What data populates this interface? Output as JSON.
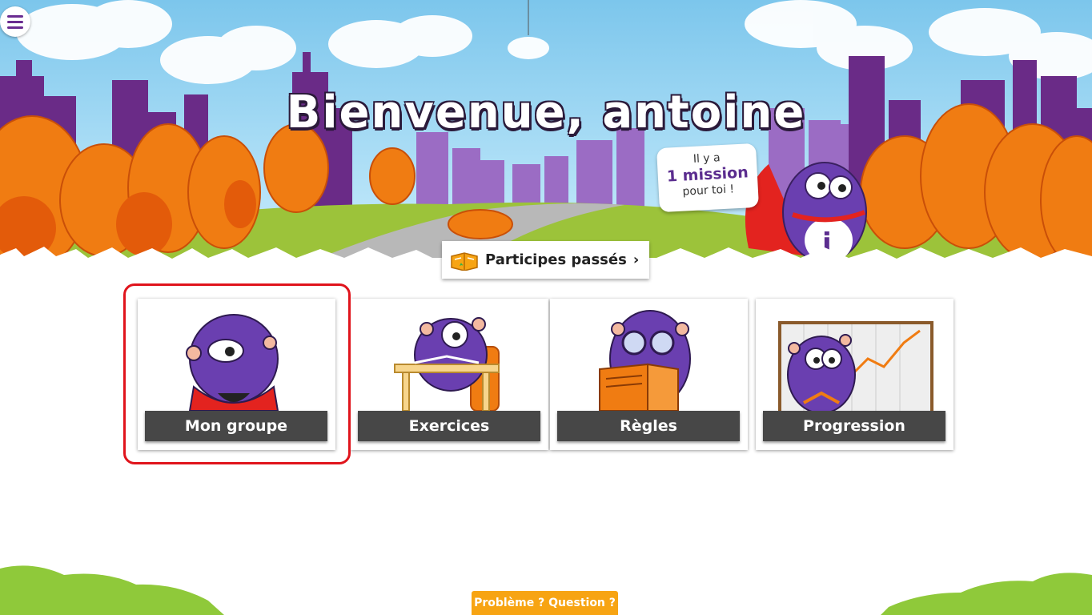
{
  "header": {
    "welcome_text": "Bienvenue, antoine",
    "mission": {
      "line1": "Il y a",
      "line2": "1 mission",
      "line3": "pour toi !"
    },
    "current_lesson": {
      "label": "Participes passés",
      "chevron": "›"
    }
  },
  "menu": {
    "icon": "hamburger-menu-icon"
  },
  "cards": [
    {
      "label": "Mon groupe",
      "icon": "superhero-mascot-illustration",
      "highlighted": true
    },
    {
      "label": "Exercices",
      "icon": "mascot-writing-at-desk-illustration",
      "highlighted": false
    },
    {
      "label": "Règles",
      "icon": "mascot-reading-book-illustration",
      "highlighted": false
    },
    {
      "label": "Progression",
      "icon": "mascot-chart-illustration",
      "highlighted": false
    }
  ],
  "footer": {
    "help_label": "Problème ? Question ?"
  },
  "colors": {
    "brand_purple": "#5b2d8f",
    "highlight_red": "#e0141c",
    "help_orange": "#f7a413",
    "card_label_bg": "#474747"
  }
}
